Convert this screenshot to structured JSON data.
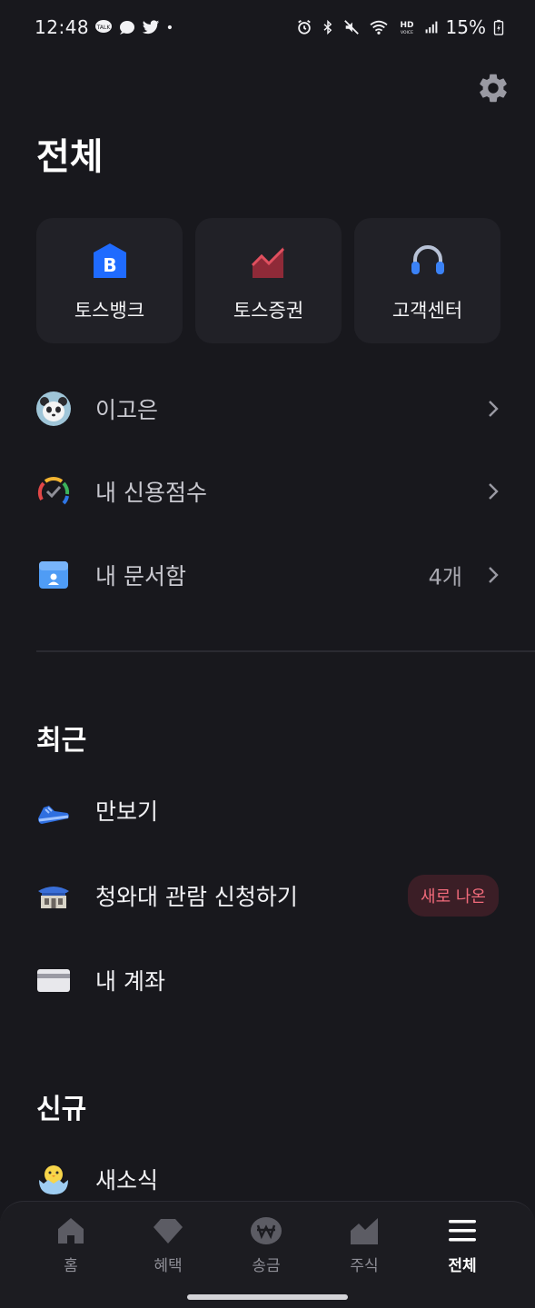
{
  "status_bar": {
    "time": "12:48",
    "battery": "15%",
    "left_icons": [
      "kakaotalk-icon",
      "chat-bubble-icon",
      "twitter-icon",
      "dot-icon"
    ],
    "right_icons": [
      "alarm-icon",
      "bluetooth-icon",
      "mute-icon",
      "wifi-icon",
      "hd-voice-icon",
      "signal-icon",
      "battery-icon"
    ]
  },
  "header": {
    "title": "전체",
    "settings_icon": "gear-icon"
  },
  "shortcuts": [
    {
      "label": "토스뱅크",
      "icon": "bank-b-icon",
      "color": "#1f6bff"
    },
    {
      "label": "토스증권",
      "icon": "stock-chart-icon",
      "color": "#c83a4a"
    },
    {
      "label": "고객센터",
      "icon": "headset-icon",
      "color": "#3b82f6"
    }
  ],
  "menu": [
    {
      "label": "이고은",
      "icon": "panda-avatar-icon",
      "count": ""
    },
    {
      "label": "내 신용점수",
      "icon": "credit-score-gauge-icon",
      "count": ""
    },
    {
      "label": "내 문서함",
      "icon": "document-box-icon",
      "count": "4개"
    }
  ],
  "recent": {
    "title": "최근",
    "items": [
      {
        "label": "만보기",
        "icon": "sneaker-icon",
        "badge": ""
      },
      {
        "label": "청와대 관람 신청하기",
        "icon": "blue-house-icon",
        "badge": "새로 나온"
      },
      {
        "label": "내 계좌",
        "icon": "card-icon",
        "badge": ""
      }
    ]
  },
  "new_section": {
    "title": "신규",
    "items": [
      {
        "label": "새소식",
        "icon": "chick-egg-icon"
      }
    ]
  },
  "bottom_nav": [
    {
      "label": "홈",
      "icon": "home-icon",
      "active": false
    },
    {
      "label": "혜택",
      "icon": "gem-icon",
      "active": false
    },
    {
      "label": "송금",
      "icon": "won-icon",
      "active": false
    },
    {
      "label": "주식",
      "icon": "stock-chart-icon",
      "active": false
    },
    {
      "label": "전체",
      "icon": "hamburger-menu-icon",
      "active": true
    }
  ],
  "colors": {
    "background": "#18181d",
    "card": "#212127",
    "badge_bg": "#3b1e26",
    "badge_text": "#f06a7a"
  }
}
